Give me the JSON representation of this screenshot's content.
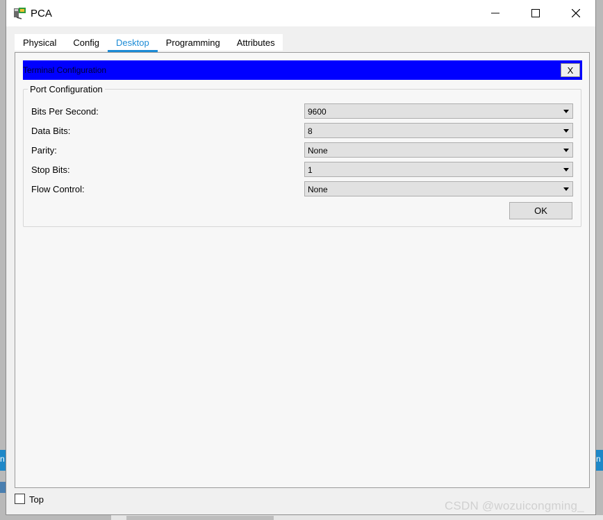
{
  "window": {
    "title": "PCA",
    "controls": {
      "minimize": "—",
      "maximize": "☐",
      "close": "✕"
    }
  },
  "tabs": [
    {
      "label": "Physical",
      "active": false
    },
    {
      "label": "Config",
      "active": false
    },
    {
      "label": "Desktop",
      "active": true
    },
    {
      "label": "Programming",
      "active": false
    },
    {
      "label": "Attributes",
      "active": false
    }
  ],
  "terminal": {
    "title": "Terminal Configuration",
    "close_label": "X",
    "bar_color": "#0000ff"
  },
  "port_config": {
    "legend": "Port Configuration",
    "fields": [
      {
        "label": "Bits Per Second:",
        "value": "9600"
      },
      {
        "label": "Data Bits:",
        "value": "8"
      },
      {
        "label": "Parity:",
        "value": "None"
      },
      {
        "label": "Stop Bits:",
        "value": "1"
      },
      {
        "label": "Flow Control:",
        "value": "None"
      }
    ],
    "ok_label": "OK"
  },
  "footer": {
    "top_label": "Top",
    "top_checked": false
  },
  "watermark": "CSDN @wozuicongming_",
  "colors": {
    "accent": "#1b8bd6",
    "terminal_bar": "#0000ff"
  }
}
